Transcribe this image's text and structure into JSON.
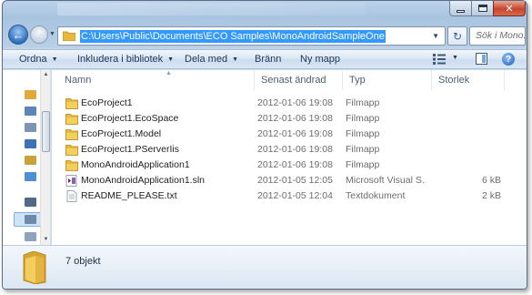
{
  "window": {
    "controls": {
      "minimize": "minimize-icon",
      "maximize": "maximize-icon",
      "close": "close-icon"
    }
  },
  "nav": {
    "back_icon": "back-arrow-icon",
    "forward_icon": "forward-arrow-icon",
    "address": "C:\\Users\\Public\\Documents\\ECO Samples\\MonoAndroidSampleOne",
    "search_placeholder": "Sök i Mono..."
  },
  "toolbar": {
    "organize": "Ordna",
    "include_in_library": "Inkludera i bibliotek",
    "share_with": "Dela med",
    "burn": "Bränn",
    "new_folder": "Ny mapp"
  },
  "columns": {
    "name": "Namn",
    "date": "Senast ändrad",
    "type": "Typ",
    "size": "Storlek"
  },
  "files": [
    {
      "name": "EcoProject1",
      "date": "2012-01-06 19:08",
      "type": "Filmapp",
      "size": "",
      "icon": "folder"
    },
    {
      "name": "EcoProject1.EcoSpace",
      "date": "2012-01-06 19:08",
      "type": "Filmapp",
      "size": "",
      "icon": "folder"
    },
    {
      "name": "EcoProject1.Model",
      "date": "2012-01-06 19:08",
      "type": "Filmapp",
      "size": "",
      "icon": "folder"
    },
    {
      "name": "EcoProject1.PServerIis",
      "date": "2012-01-06 19:08",
      "type": "Filmapp",
      "size": "",
      "icon": "folder"
    },
    {
      "name": "MonoAndroidApplication1",
      "date": "2012-01-06 19:08",
      "type": "Filmapp",
      "size": "",
      "icon": "folder"
    },
    {
      "name": "MonoAndroidApplication1.sln",
      "date": "2012-01-05 12:05",
      "type": "Microsoft Visual S...",
      "size": "6 kB",
      "icon": "sln"
    },
    {
      "name": "README_PLEASE.txt",
      "date": "2012-01-05 12:04",
      "type": "Textdokument",
      "size": "2 kB",
      "icon": "txt"
    }
  ],
  "details": {
    "count": "7 objekt"
  },
  "colors": {
    "selection": "#3399ff",
    "folder": "#e8b93a",
    "chrome": "#c9dbee"
  }
}
